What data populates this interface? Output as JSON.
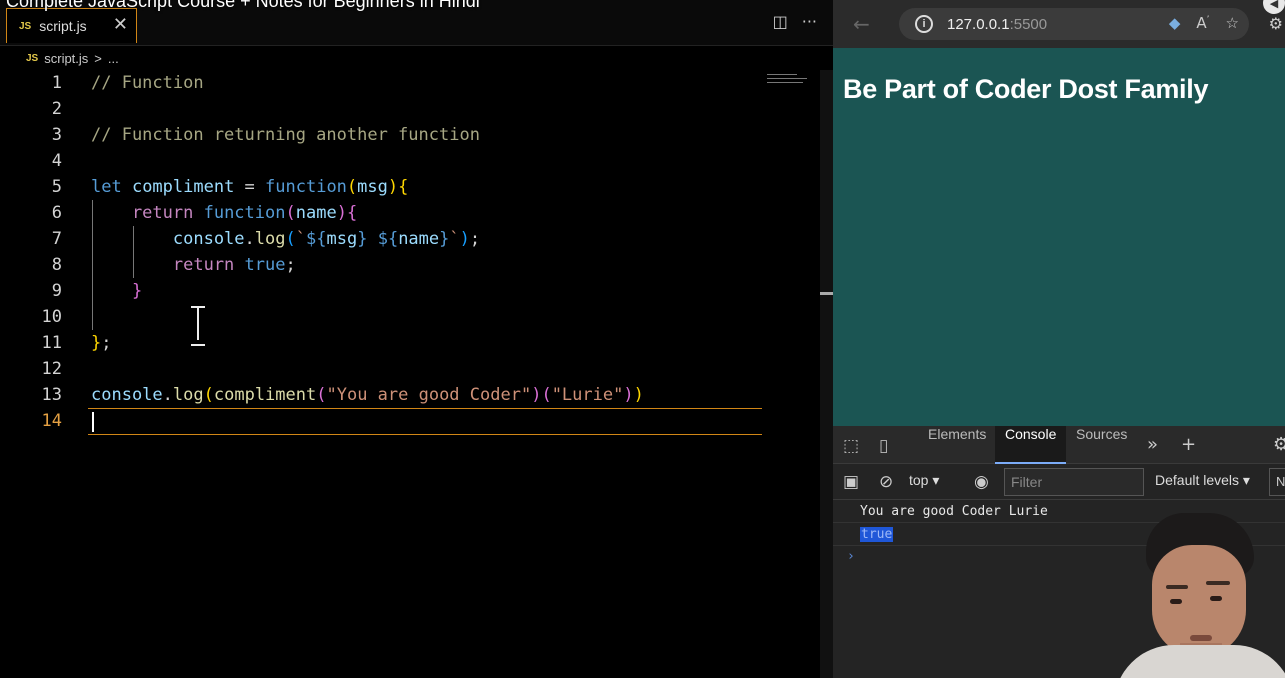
{
  "video": {
    "title": "Complete JavaScript Course + Notes for Beginners in Hindi"
  },
  "editor": {
    "tab": {
      "badge": "JS",
      "label": "script.js",
      "close": "✕"
    },
    "breadcrumb": {
      "badge": "JS",
      "file": "script.js",
      "separator": ">",
      "rest": "..."
    },
    "active_line": 14
  },
  "code_lines": [
    {
      "num": "1",
      "tokens": [
        {
          "t": "// Function",
          "c": "cmt"
        }
      ]
    },
    {
      "num": "2",
      "tokens": []
    },
    {
      "num": "3",
      "tokens": [
        {
          "t": "// Function returning another function",
          "c": "cmt"
        }
      ]
    },
    {
      "num": "4",
      "tokens": []
    },
    {
      "num": "5",
      "tokens": [
        {
          "t": "let ",
          "c": "kw"
        },
        {
          "t": "compliment",
          "c": "var"
        },
        {
          "t": " = ",
          "c": "def"
        },
        {
          "t": "function",
          "c": "kw"
        },
        {
          "t": "(",
          "c": "p1"
        },
        {
          "t": "msg",
          "c": "var"
        },
        {
          "t": ")",
          "c": "p1"
        },
        {
          "t": "{",
          "c": "p1"
        }
      ]
    },
    {
      "num": "6",
      "tokens": [
        {
          "t": "    return ",
          "c": "ret"
        },
        {
          "t": "function",
          "c": "kw"
        },
        {
          "t": "(",
          "c": "p2"
        },
        {
          "t": "name",
          "c": "var"
        },
        {
          "t": ")",
          "c": "p2"
        },
        {
          "t": "{",
          "c": "p2"
        }
      ]
    },
    {
      "num": "7",
      "tokens": [
        {
          "t": "        console",
          "c": "var"
        },
        {
          "t": ".",
          "c": "def"
        },
        {
          "t": "log",
          "c": "fn"
        },
        {
          "t": "(",
          "c": "p3"
        },
        {
          "t": "`",
          "c": "str"
        },
        {
          "t": "${",
          "c": "kw"
        },
        {
          "t": "msg",
          "c": "var"
        },
        {
          "t": "}",
          "c": "kw"
        },
        {
          "t": " ",
          "c": "str"
        },
        {
          "t": "${",
          "c": "kw"
        },
        {
          "t": "name",
          "c": "var"
        },
        {
          "t": "}",
          "c": "kw"
        },
        {
          "t": "`",
          "c": "str"
        },
        {
          "t": ")",
          "c": "p3"
        },
        {
          "t": ";",
          "c": "def"
        }
      ]
    },
    {
      "num": "8",
      "tokens": [
        {
          "t": "        return ",
          "c": "ret"
        },
        {
          "t": "true",
          "c": "kw"
        },
        {
          "t": ";",
          "c": "def"
        }
      ]
    },
    {
      "num": "9",
      "tokens": [
        {
          "t": "    }",
          "c": "p2"
        }
      ]
    },
    {
      "num": "10",
      "tokens": []
    },
    {
      "num": "11",
      "tokens": [
        {
          "t": "}",
          "c": "p1"
        },
        {
          "t": ";",
          "c": "def"
        }
      ]
    },
    {
      "num": "12",
      "tokens": []
    },
    {
      "num": "13",
      "tokens": [
        {
          "t": "console",
          "c": "var"
        },
        {
          "t": ".",
          "c": "def"
        },
        {
          "t": "log",
          "c": "fn"
        },
        {
          "t": "(",
          "c": "p1"
        },
        {
          "t": "compliment",
          "c": "fn"
        },
        {
          "t": "(",
          "c": "p2"
        },
        {
          "t": "\"You are good Coder\"",
          "c": "str"
        },
        {
          "t": ")",
          "c": "p2"
        },
        {
          "t": "(",
          "c": "p2"
        },
        {
          "t": "\"Lurie\"",
          "c": "str"
        },
        {
          "t": ")",
          "c": "p2"
        },
        {
          "t": ")",
          "c": "p1"
        }
      ]
    },
    {
      "num": "14",
      "tokens": []
    }
  ],
  "browser": {
    "url_host": "127.0.0.1",
    "url_port": ":5500",
    "page_heading": "Be Part of Coder Dost Family",
    "colors": {
      "page_bg": "#1b5553",
      "devtools_active": "#7cacf8"
    }
  },
  "devtools": {
    "tabs": [
      {
        "label": "Elements",
        "active": false
      },
      {
        "label": "Console",
        "active": true
      },
      {
        "label": "Sources",
        "active": false
      }
    ],
    "context": "top",
    "filter_placeholder": "Filter",
    "levels": "Default levels",
    "levels_extra": "N",
    "messages": [
      "You are good Coder Lurie",
      "true"
    ],
    "prompt": "›"
  }
}
